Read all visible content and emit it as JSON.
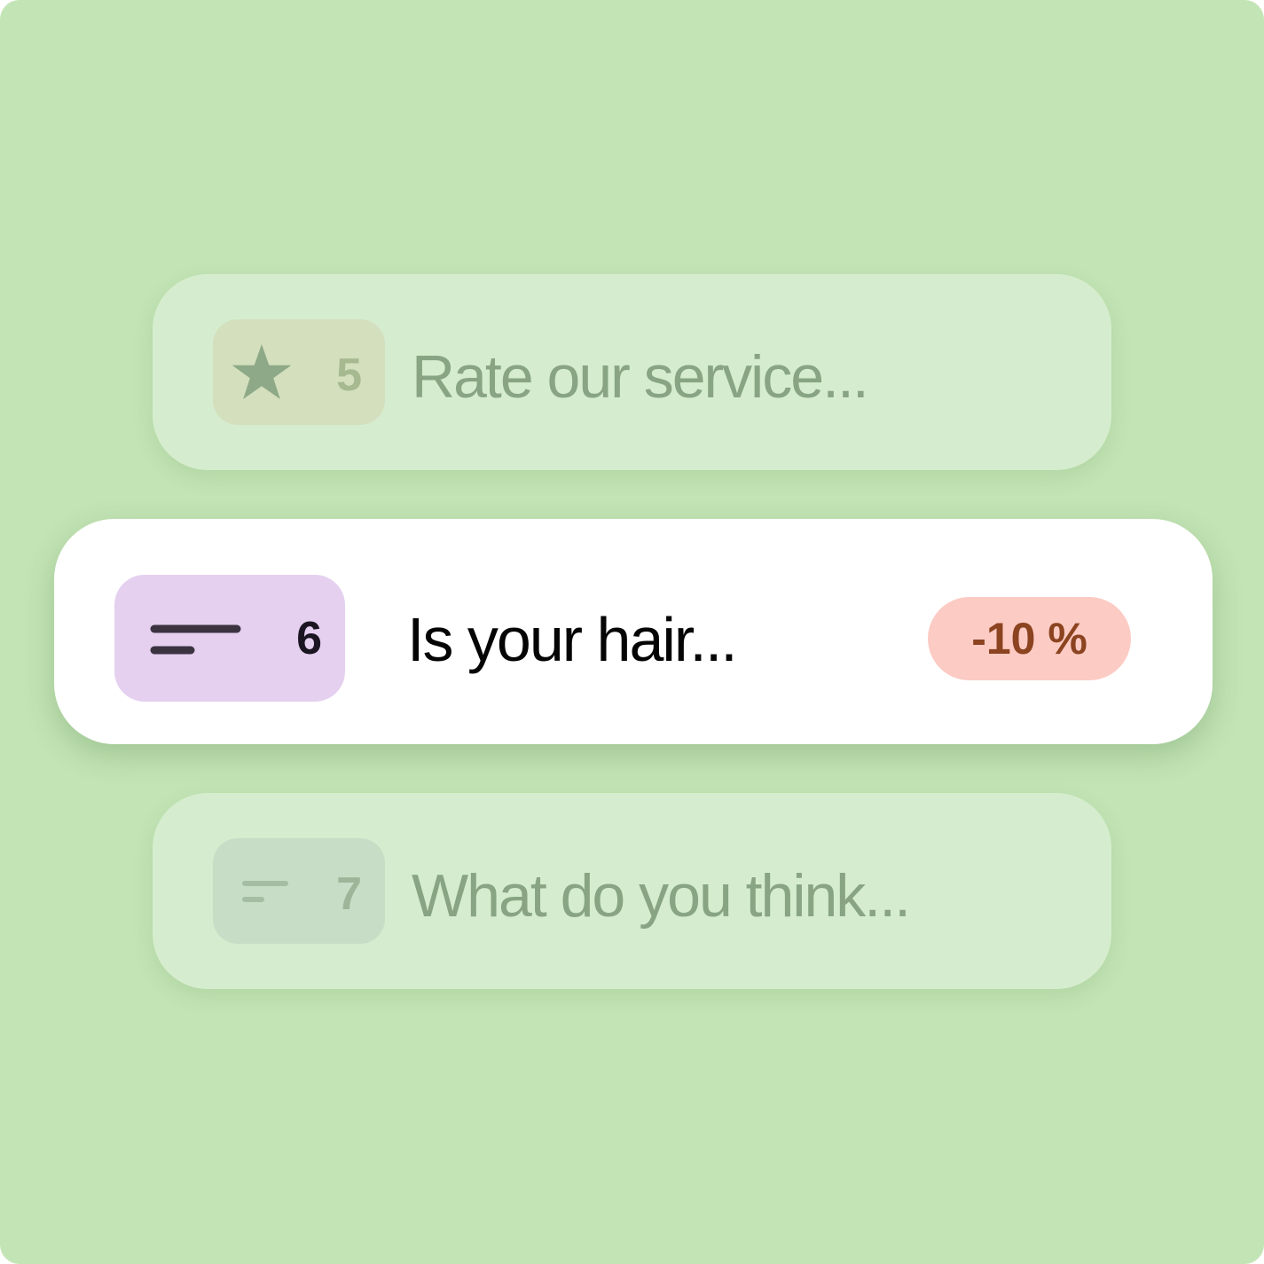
{
  "colors": {
    "background": "#c3e4b5",
    "faded_card": "#d5edce",
    "active_card": "#ffffff",
    "active_tag": "#e5d0f0",
    "discount_badge": "#fccbc4",
    "discount_text": "#8b4320"
  },
  "questions": [
    {
      "number": "5",
      "icon": "star-icon",
      "text": "Rate our service...",
      "state": "faded"
    },
    {
      "number": "6",
      "icon": "text-lines-icon",
      "text": "Is your hair...",
      "state": "active",
      "badge": "-10 %"
    },
    {
      "number": "7",
      "icon": "text-lines-icon",
      "text": "What do you think...",
      "state": "faded"
    }
  ]
}
